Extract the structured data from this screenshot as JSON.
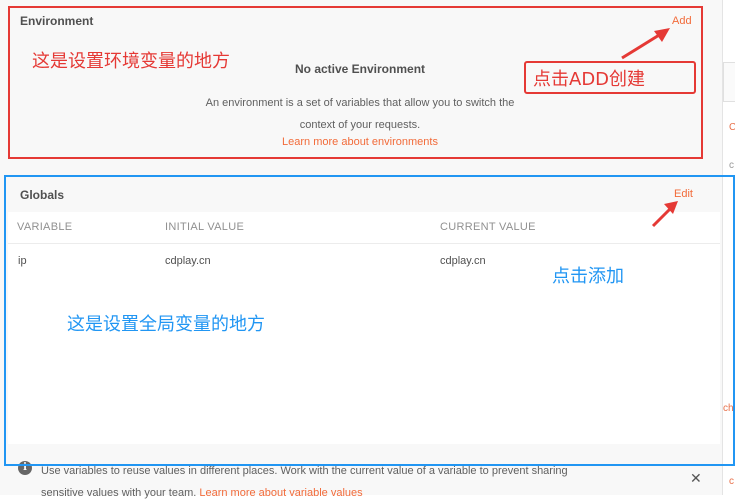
{
  "environment": {
    "title": "Environment",
    "add_label": "Add",
    "empty_title": "No active Environment",
    "empty_desc_line1": "An environment is a set of variables that allow you to switch the",
    "empty_desc_line2": "context of your requests.",
    "learn_more": "Learn more about environments"
  },
  "globals": {
    "title": "Globals",
    "edit_label": "Edit",
    "columns": [
      "VARIABLE",
      "INITIAL VALUE",
      "CURRENT VALUE"
    ],
    "rows": [
      {
        "variable": "ip",
        "initial": "cdplay.cn",
        "current": "cdplay.cn"
      }
    ]
  },
  "info": {
    "text_line1": "Use variables to reuse values in different places. Work with the current value of a variable to prevent sharing",
    "text_line2_prefix": "sensitive values with your team. ",
    "learn_more": "Learn more about variable values"
  },
  "annotations": {
    "env_note": "这是设置环境变量的地方",
    "add_note": "点击ADD创建",
    "globals_note": "这是设置全局变量的地方",
    "edit_note": "点击添加"
  },
  "right_strip": {
    "mark1": "C",
    "mark2": "c",
    "mark3": "ch",
    "mark4": "c"
  },
  "colors": {
    "accent": "#f26b3a",
    "annotation_red": "#e53935",
    "annotation_blue": "#2196f3"
  }
}
